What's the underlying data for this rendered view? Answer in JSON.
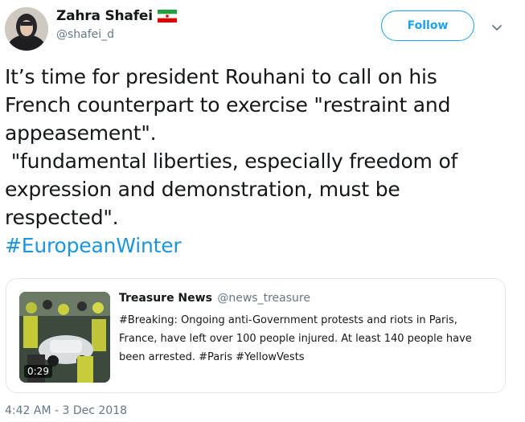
{
  "author": {
    "display_name": "Zahra Shafei",
    "handle": "@shafei_d",
    "flag": "iran-flag-icon"
  },
  "actions": {
    "follow_label": "Follow",
    "menu_icon": "chevron-down-icon"
  },
  "tweet": {
    "line1": "It’s time for president Rouhani to call on his",
    "line2": "French counterpart to exercise \"restraint and",
    "line3": "appeasement\".",
    "line4": " \"fundamental liberties, especially freedom of",
    "line5": "expression and demonstration, must be",
    "line6": "respected\".",
    "hashtag": "#EuropeanWinter"
  },
  "quoted": {
    "name": "Treasure News",
    "handle": "@news_treasure",
    "body_line1": "#Breaking: Ongoing anti-Government protests and riots in Paris,",
    "body_line2": "France, have left over 100 people injured. At least 140 people have",
    "body_line3": "been arrested. #Paris #YellowVests",
    "video_duration": "0:29"
  },
  "timestamp": "4:42 AM - 3 Dec 2018",
  "colors": {
    "accent": "#1da1f2",
    "hashtag": "#1b95e0",
    "secondary_text": "#657786",
    "border": "#e1e8ed"
  }
}
